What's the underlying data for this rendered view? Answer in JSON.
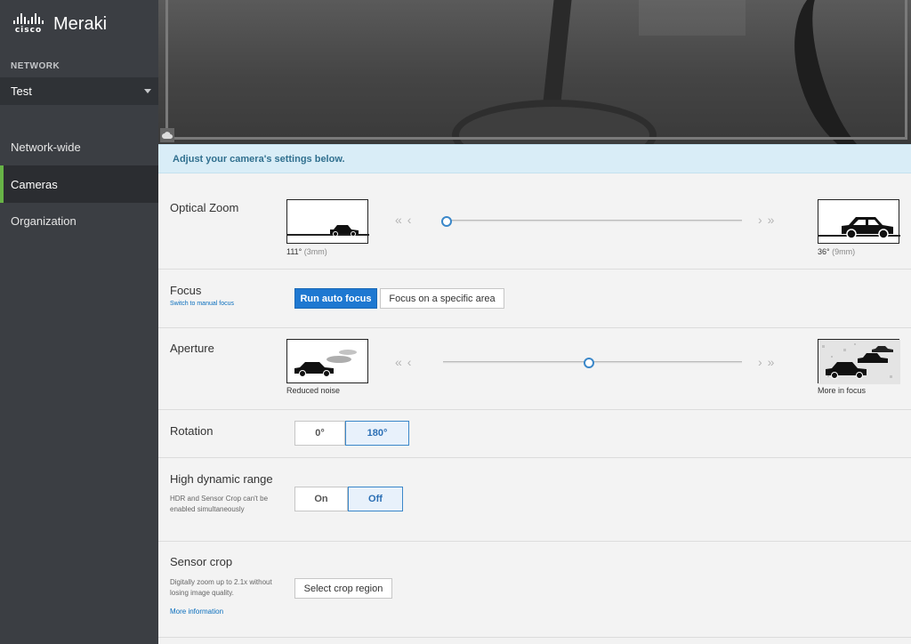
{
  "brand": {
    "cisco": "cisco",
    "product": "Meraki"
  },
  "sidebar": {
    "network_label": "NETWORK",
    "network_value": "Test",
    "items": [
      {
        "label": "Network-wide",
        "active": false
      },
      {
        "label": "Cameras",
        "active": true
      },
      {
        "label": "Organization",
        "active": false
      }
    ]
  },
  "banner": "Adjust your camera's settings below.",
  "optical_zoom": {
    "title": "Optical Zoom",
    "left_angle": "111°",
    "left_mm": "(3mm)",
    "right_angle": "36°",
    "right_mm": "(9mm)",
    "slider_value": 0
  },
  "focus": {
    "title": "Focus",
    "sub_link": "Switch to manual focus",
    "auto_button": "Run auto focus",
    "area_button": "Focus on a specific area"
  },
  "aperture": {
    "title": "Aperture",
    "left_caption": "Reduced noise",
    "right_caption": "More in focus",
    "slider_value": 0.5
  },
  "rotation": {
    "title": "Rotation",
    "options": [
      "0°",
      "180°"
    ],
    "selected": "180°"
  },
  "hdr": {
    "title": "High dynamic range",
    "note": "HDR and Sensor Crop can't be enabled simultaneously",
    "options": [
      "On",
      "Off"
    ],
    "selected": "Off"
  },
  "sensor_crop": {
    "title": "Sensor crop",
    "note": "Digitally zoom up to 2.1x without losing image quality.",
    "more_link": "More information",
    "button": "Select crop region"
  },
  "colors": {
    "accent": "#1e78d1",
    "sidebar": "#3b3e43",
    "active_bar": "#67b346",
    "banner": "#d9edf7"
  }
}
